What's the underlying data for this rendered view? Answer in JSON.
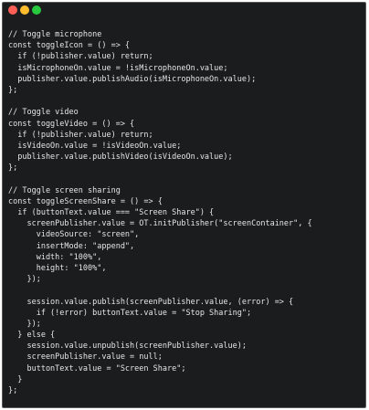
{
  "window": {
    "buttons": {
      "close_color": "#ff5f56",
      "minimize_color": "#ffbd2e",
      "maximize_color": "#27c93f"
    }
  },
  "editor": {
    "text_color": "#e6e6e6",
    "background_color": "#1b1c1e",
    "cursor_after_line": 34,
    "lines": [
      "// Toggle microphone",
      "const toggleIcon = () => {",
      "  if (!publisher.value) return;",
      "  isMicrophoneOn.value = !isMicrophoneOn.value;",
      "  publisher.value.publishAudio(isMicrophoneOn.value);",
      "};",
      "",
      "// Toggle video",
      "const toggleVideo = () => {",
      "  if (!publisher.value) return;",
      "  isVideoOn.value = !isVideoOn.value;",
      "  publisher.value.publishVideo(isVideoOn.value);",
      "};",
      "",
      "// Toggle screen sharing",
      "const toggleScreenShare = () => {",
      "  if (buttonText.value === \"Screen Share\") {",
      "    screenPublisher.value = OT.initPublisher(\"screenContainer\", {",
      "      videoSource: \"screen\",",
      "      insertMode: \"append\",",
      "      width: \"100%\",",
      "      height: \"100%\",",
      "    });",
      "",
      "    session.value.publish(screenPublisher.value, (error) => {",
      "      if (!error) buttonText.value = \"Stop Sharing\";",
      "    });",
      "  } else {",
      "    session.value.unpublish(screenPublisher.value);",
      "    screenPublisher.value = null;",
      "    buttonText.value = \"Screen Share\";",
      "  }",
      "};"
    ]
  }
}
